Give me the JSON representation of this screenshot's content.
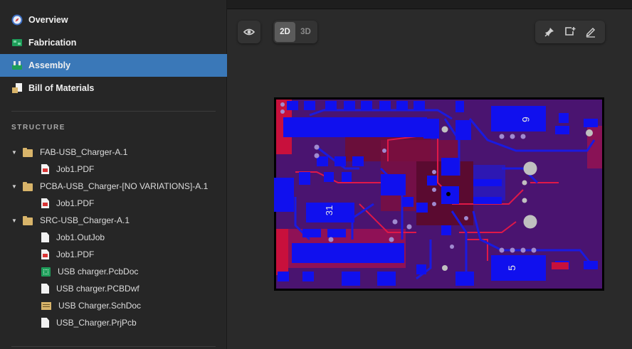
{
  "nav": [
    {
      "label": "Overview",
      "icon": "compass-icon",
      "active": false
    },
    {
      "label": "Fabrication",
      "icon": "pcb-board-icon",
      "active": false
    },
    {
      "label": "Assembly",
      "icon": "assembly-icon",
      "active": true
    },
    {
      "label": "Bill of Materials",
      "icon": "bom-icon",
      "active": false
    }
  ],
  "structure": {
    "title": "STRUCTURE",
    "items": [
      {
        "label": "FAB-USB_Charger-A.1",
        "level": 0,
        "type": "folder",
        "expanded": true
      },
      {
        "label": "Job1.PDF",
        "level": 1,
        "type": "pdf"
      },
      {
        "label": "PCBA-USB_Charger-[NO VARIATIONS]-A.1",
        "level": 0,
        "type": "folder",
        "expanded": true
      },
      {
        "label": "Job1.PDF",
        "level": 1,
        "type": "pdf"
      },
      {
        "label": "SRC-USB_Charger-A.1",
        "level": 0,
        "type": "folder",
        "expanded": true
      },
      {
        "label": "Job1.OutJob",
        "level": 1,
        "type": "doc"
      },
      {
        "label": "Job1.PDF",
        "level": 1,
        "type": "pdf"
      },
      {
        "label": "USB charger.PcbDoc",
        "level": 1,
        "type": "pcb"
      },
      {
        "label": "USB charger.PCBDwf",
        "level": 1,
        "type": "doc"
      },
      {
        "label": "USB Charger.SchDoc",
        "level": 1,
        "type": "sch"
      },
      {
        "label": "USB_Charger.PrjPcb",
        "level": 1,
        "type": "doc"
      }
    ]
  },
  "viewer": {
    "mode_2d": "2D",
    "mode_3d": "3D",
    "active_mode": "2D",
    "toolbar_icons": [
      "pin-icon",
      "add-comment-icon",
      "draw-icon"
    ]
  },
  "board": {
    "labels": [
      "6",
      "5",
      "31"
    ],
    "colors": {
      "substrate": "#4a1470",
      "top_copper": "#1010ee",
      "bottom_copper": "#c8103c",
      "pads": "#c0c0c0",
      "outline": "#000000"
    }
  },
  "colors": {
    "accent": "#3a78b8",
    "background": "#2a2a2a",
    "sidebar": "#262626"
  }
}
